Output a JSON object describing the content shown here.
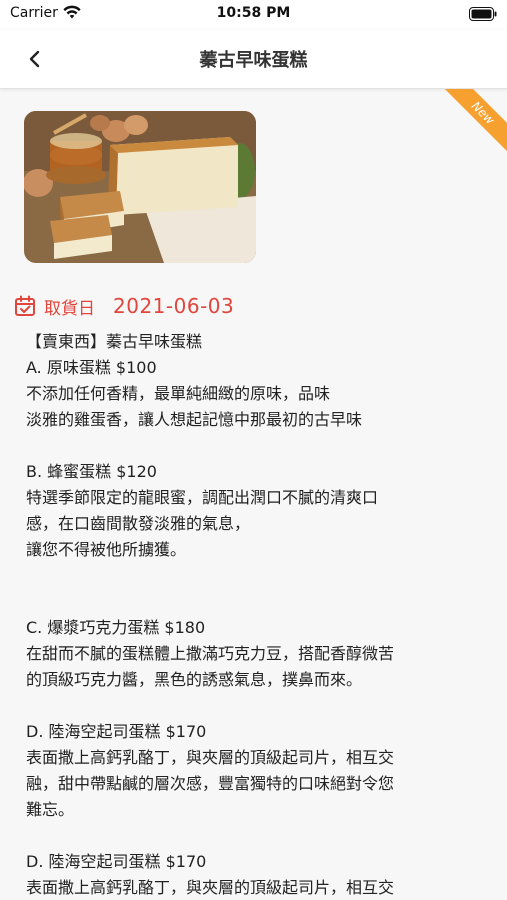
{
  "status_bar": {
    "carrier": "Carrier",
    "time": "10:58 PM"
  },
  "nav": {
    "title": "蓁古早味蛋糕",
    "back_icon": "chevron-left-icon"
  },
  "badge": {
    "text": "New",
    "color": "#f6a030"
  },
  "pickup": {
    "label": "取貨日",
    "date": "2021-06-03",
    "icon": "calendar-check-icon",
    "color": "#e0463d"
  },
  "description": {
    "title": "【賣東西】蓁古早味蛋糕",
    "a_name": "A. 原味蛋糕 $100",
    "a_line1": "不添加任何香精，最單純細緻的原味，品味",
    "a_line2": "淡雅的雞蛋香，讓人想起記憶中那最初的古早味",
    "b_name": "B. 蜂蜜蛋糕 $120",
    "b_line1": "特選季節限定的龍眼蜜，調配出潤口不膩的清爽口",
    "b_line2": "感，在口齒間散發淡雅的氣息，",
    "b_line3": "讓您不得被他所擄獲。",
    "c_name": "C. 爆漿巧克力蛋糕 $180",
    "c_line1": "在甜而不膩的蛋糕體上撒滿巧克力豆，搭配香醇微苦",
    "c_line2": "的頂級巧克力醬，黑色的誘惑氣息，撲鼻而來。",
    "d_name": "D. 陸海空起司蛋糕 $170",
    "d_line1": "表面撒上高鈣乳酪丁，與夾層的頂級起司片，相互交",
    "d_line2": "融，甜中帶點鹹的層次感，豐富獨特的口味絕對令您",
    "d_line3": "難忘。",
    "d2_name": "D. 陸海空起司蛋糕 $170",
    "d2_line1": "表面撒上高鈣乳酪丁，與夾層的頂級起司片，相互交"
  }
}
